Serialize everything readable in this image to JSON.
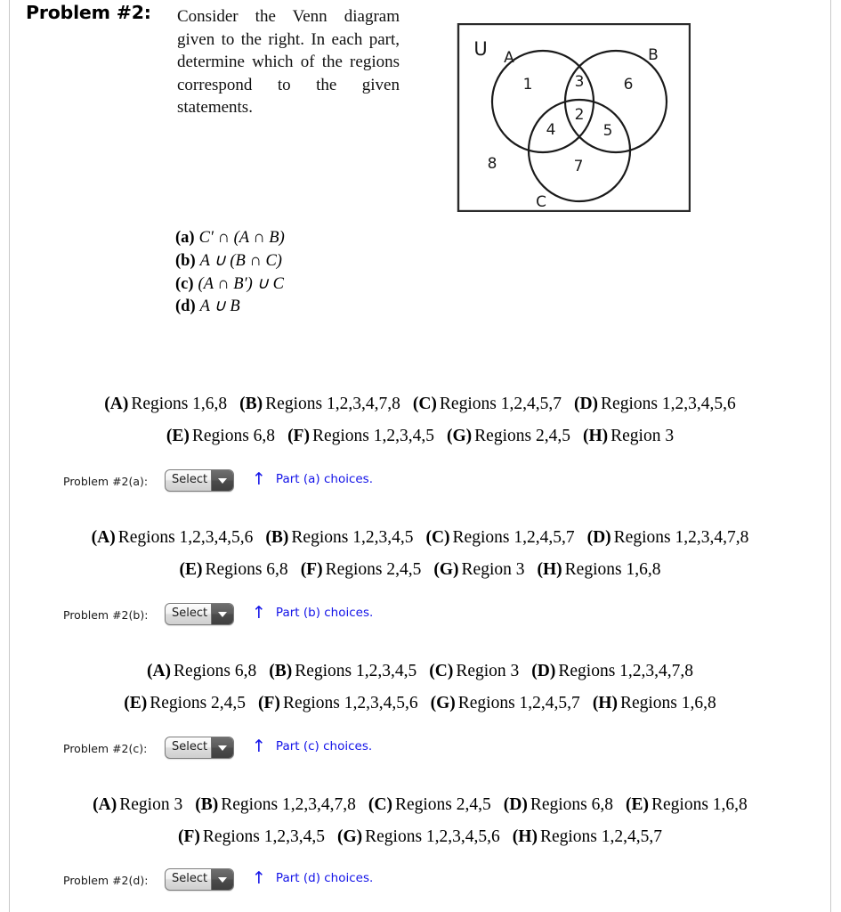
{
  "header": {
    "problem_label": "Problem #2:",
    "prompt": "Consider the Venn diagram given to the right. In each part, determine which of the regions correspond to the given statements."
  },
  "venn": {
    "universe_label": "U",
    "set_labels": {
      "a": "A",
      "b": "B",
      "c": "C"
    },
    "region_numbers": [
      "1",
      "3",
      "6",
      "2",
      "4",
      "5",
      "8",
      "7"
    ],
    "region_1": "1",
    "region_2": "2",
    "region_3": "3",
    "region_4": "4",
    "region_5": "5",
    "region_6": "6",
    "region_7": "7",
    "region_8": "8"
  },
  "parts": [
    {
      "tag": "(a)",
      "expr_html": "C′ ∩ (A ∩ B)",
      "expr_plain": "C' ∩ (A ∩ B)"
    },
    {
      "tag": "(b)",
      "expr_html": "A ∪ (B ∩ C)",
      "expr_plain": "A ∪ (B ∩ C)"
    },
    {
      "tag": "(c)",
      "expr_html": "(A ∩ B′) ∪ C",
      "expr_plain": "(A ∩ B') ∪ C"
    },
    {
      "tag": "(d)",
      "expr_html": "A ∪ B",
      "expr_plain": "A ∪ B"
    }
  ],
  "blocks": [
    {
      "id": "a",
      "rows": [
        [
          {
            "key": "(A)",
            "text": "Regions 1,6,8"
          },
          {
            "key": "(B)",
            "text": "Regions 1,2,3,4,7,8"
          },
          {
            "key": "(C)",
            "text": "Regions 1,2,4,5,7"
          },
          {
            "key": "(D)",
            "text": "Regions 1,2,3,4,5,6"
          }
        ],
        [
          {
            "key": "(E)",
            "text": "Regions 6,8"
          },
          {
            "key": "(F)",
            "text": "Regions 1,2,3,4,5"
          },
          {
            "key": "(G)",
            "text": "Regions 2,4,5"
          },
          {
            "key": "(H)",
            "text": "Region 3"
          }
        ]
      ],
      "select": {
        "label": "Problem #2(a):",
        "value": "Select",
        "hint": "Part (a) choices.",
        "arrow": "↑"
      }
    },
    {
      "id": "b",
      "rows": [
        [
          {
            "key": "(A)",
            "text": "Regions 1,2,3,4,5,6"
          },
          {
            "key": "(B)",
            "text": "Regions 1,2,3,4,5"
          },
          {
            "key": "(C)",
            "text": "Regions 1,2,4,5,7"
          },
          {
            "key": "(D)",
            "text": "Regions 1,2,3,4,7,8"
          }
        ],
        [
          {
            "key": "(E)",
            "text": "Regions 6,8"
          },
          {
            "key": "(F)",
            "text": "Regions 2,4,5"
          },
          {
            "key": "(G)",
            "text": "Region 3"
          },
          {
            "key": "(H)",
            "text": "Regions 1,6,8"
          }
        ]
      ],
      "select": {
        "label": "Problem #2(b):",
        "value": "Select",
        "hint": "Part (b) choices.",
        "arrow": "↑"
      }
    },
    {
      "id": "c",
      "rows": [
        [
          {
            "key": "(A)",
            "text": "Regions 6,8"
          },
          {
            "key": "(B)",
            "text": "Regions 1,2,3,4,5"
          },
          {
            "key": "(C)",
            "text": "Region 3"
          },
          {
            "key": "(D)",
            "text": "Regions 1,2,3,4,7,8"
          }
        ],
        [
          {
            "key": "(E)",
            "text": "Regions 2,4,5"
          },
          {
            "key": "(F)",
            "text": "Regions 1,2,3,4,5,6"
          },
          {
            "key": "(G)",
            "text": "Regions 1,2,4,5,7"
          },
          {
            "key": "(H)",
            "text": "Regions 1,6,8"
          }
        ]
      ],
      "select": {
        "label": "Problem #2(c):",
        "value": "Select",
        "hint": "Part (c) choices.",
        "arrow": "↑"
      }
    },
    {
      "id": "d",
      "rows": [
        [
          {
            "key": "(A)",
            "text": "Region 3"
          },
          {
            "key": "(B)",
            "text": "Regions 1,2,3,4,7,8"
          },
          {
            "key": "(C)",
            "text": "Regions 2,4,5"
          },
          {
            "key": "(D)",
            "text": "Regions 6,8"
          },
          {
            "key": "(E)",
            "text": "Regions 1,6,8"
          }
        ],
        [
          {
            "key": "(F)",
            "text": "Regions 1,2,3,4,5"
          },
          {
            "key": "(G)",
            "text": "Regions 1,2,3,4,5,6"
          },
          {
            "key": "(H)",
            "text": "Regions 1,2,4,5,7"
          }
        ]
      ],
      "select": {
        "label": "Problem #2(d):",
        "value": "Select",
        "hint": "Part (d) choices.",
        "arrow": "↑"
      }
    }
  ],
  "colors": {
    "hint_blue": "#1313e8",
    "page_rule": "#c9c9c9",
    "text": "#000000"
  }
}
